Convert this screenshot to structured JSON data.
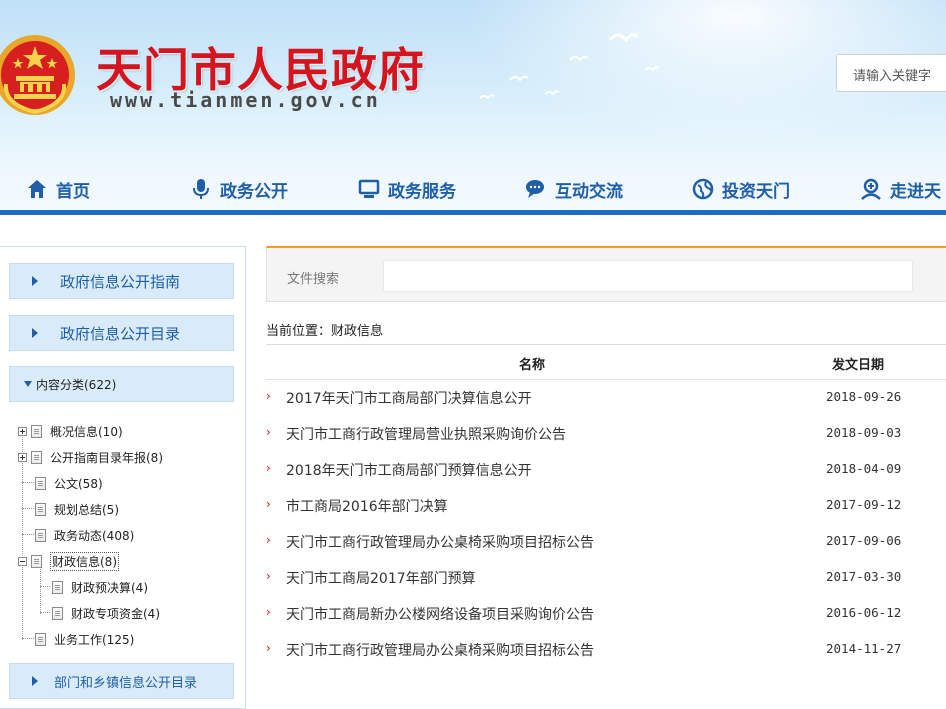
{
  "header": {
    "site_title": "天门市人民政府",
    "site_url": "www.tianmen.gov.cn",
    "search_placeholder": "请输入关键字"
  },
  "nav": [
    {
      "label": "首页",
      "icon": "home-icon"
    },
    {
      "label": "政务公开",
      "icon": "microphone-icon"
    },
    {
      "label": "政务服务",
      "icon": "monitor-icon"
    },
    {
      "label": "互动交流",
      "icon": "chat-icon"
    },
    {
      "label": "投资天门",
      "icon": "globe-icon"
    },
    {
      "label": "走进天",
      "icon": "person-icon"
    }
  ],
  "sidebar": {
    "guide": "政府信息公开指南",
    "catalog": "政府信息公开目录",
    "category": "内容分类(622)",
    "tree": [
      {
        "label": "概况信息(10)"
      },
      {
        "label": "公开指南目录年报(8)"
      },
      {
        "label": "公文(58)"
      },
      {
        "label": "规划总结(5)"
      },
      {
        "label": "政务动态(408)"
      },
      {
        "label": "财政信息(8)"
      },
      {
        "label": "财政预决算(4)"
      },
      {
        "label": "财政专项资金(4)"
      },
      {
        "label": "业务工作(125)"
      }
    ],
    "dept": "部门和乡镇信息公开目录"
  },
  "main": {
    "filter_label": "文件搜索",
    "breadcrumb": "当前位置：财政信息",
    "col_name": "名称",
    "col_date": "发文日期",
    "rows": [
      {
        "title": "2017年天门市工商局部门决算信息公开",
        "date": "2018-09-26"
      },
      {
        "title": "天门市工商行政管理局营业执照采购询价公告",
        "date": "2018-09-03"
      },
      {
        "title": "2018年天门市工商局部门预算信息公开",
        "date": "2018-04-09"
      },
      {
        "title": "市工商局2016年部门决算",
        "date": "2017-09-12"
      },
      {
        "title": "天门市工商行政管理局办公桌椅采购项目招标公告",
        "date": "2017-09-06"
      },
      {
        "title": "天门市工商局2017年部门预算",
        "date": "2017-03-30"
      },
      {
        "title": "天门市工商局新办公楼网络设备项目采购询价公告",
        "date": "2016-06-12"
      },
      {
        "title": "天门市工商行政管理局办公桌椅采购项目招标公告",
        "date": "2014-11-27"
      }
    ]
  },
  "colors": {
    "brand_blue": "#1e6ebd",
    "title_red": "#d4141e",
    "filter_accent": "#f09a2a"
  }
}
